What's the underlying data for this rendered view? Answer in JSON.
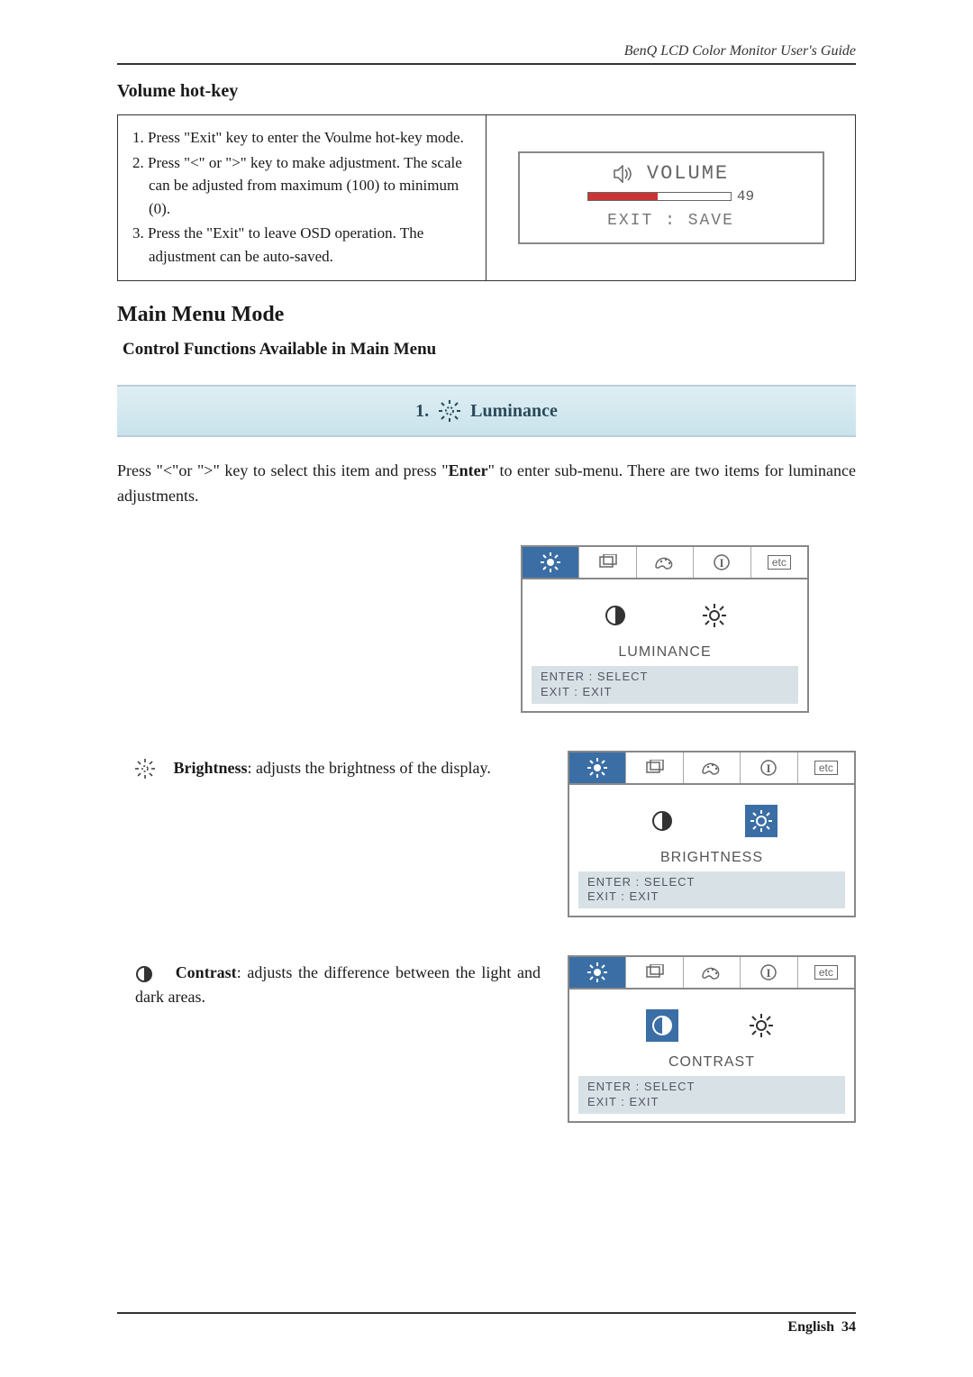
{
  "header": {
    "right": "BenQ LCD Color Monitor User's Guide"
  },
  "section": {
    "volume_title": "Volume hot-key"
  },
  "volume": {
    "steps": [
      "1. Press \"Exit\" key to enter the Voulme hot-key mode.",
      "2. Press \"<\" or \">\" key to make adjustment. The scale can be adjusted from maximum (100) to minimum (0).",
      "3. Press the \"Exit\" to leave OSD operation. The adjustment can be auto-saved."
    ],
    "osd": {
      "label": "VOLUME",
      "value": "49",
      "exit": "EXIT : SAVE"
    }
  },
  "main_menu": {
    "title": "Main Menu Mode",
    "subtitle": "Control Functions Available in Main Menu"
  },
  "banner": {
    "num": "1.",
    "label": "Luminance"
  },
  "intro": {
    "pre": "Press  \"<\"or \">\" key to select this item and press  \"",
    "bold": "Enter",
    "post": "\" to enter sub-menu. There are two items for luminance adjustments."
  },
  "osd_common": {
    "tabs_etc": "etc",
    "footer_enter": "ENTER : SELECT",
    "footer_exit": "EXIT : EXIT"
  },
  "panel1": {
    "label": "LUMINANCE"
  },
  "brightness": {
    "name": "Brightness",
    "desc": ": adjusts the brightness of the display.",
    "osd_label": "BRIGHTNESS"
  },
  "contrast": {
    "name": "Contrast",
    "desc": ": adjusts the difference between the light and dark areas.",
    "osd_label": "CONTRAST"
  },
  "footer": {
    "lang": "English",
    "page": "34"
  }
}
